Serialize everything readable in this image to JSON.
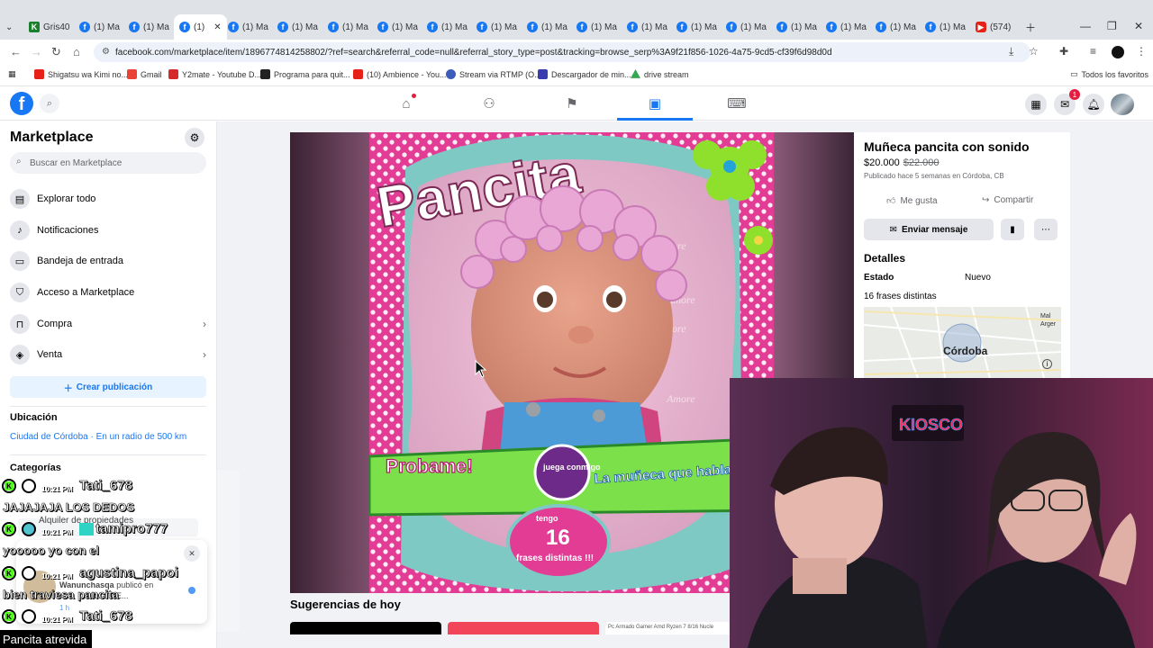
{
  "browser": {
    "tabs": [
      {
        "label": "Gris40"
      },
      {
        "label": "(1) Ma"
      },
      {
        "label": "(1) Ma"
      },
      {
        "label": "(1)"
      },
      {
        "label": "(1) Ma"
      },
      {
        "label": "(1) Ma"
      },
      {
        "label": "(1) Ma"
      },
      {
        "label": "(1) Ma"
      },
      {
        "label": "(1) Ma"
      },
      {
        "label": "(1) Ma"
      },
      {
        "label": "(1) Ma"
      },
      {
        "label": "(1) Ma"
      },
      {
        "label": "(1) Ma"
      },
      {
        "label": "(1) Ma"
      },
      {
        "label": "(1) Ma"
      },
      {
        "label": "(1) Ma"
      },
      {
        "label": "(1) Ma"
      },
      {
        "label": "(1) Ma"
      },
      {
        "label": "(1) Ma"
      },
      {
        "label": "(574)"
      }
    ],
    "url": "facebook.com/marketplace/item/1896774814258802/?ref=search&referral_code=null&referral_story_type=post&tracking=browse_serp%3A9f21f856-1026-4a75-9cd5-cf39f6d98d0d",
    "bookmarks": [
      {
        "label": "Shigatsu wa Kimi no...",
        "color": "#e62117"
      },
      {
        "label": "Gmail",
        "color": "#ea4335"
      },
      {
        "label": "Y2mate - Youtube D...",
        "color": "#d62a2a"
      },
      {
        "label": "Programa para quit...",
        "color": "#222222"
      },
      {
        "label": "(10) Ambience - You...",
        "color": "#e62117"
      },
      {
        "label": "Stream via RTMP (O...",
        "color": "#3b5cb8"
      },
      {
        "label": "Descargador de min...",
        "color": "#3b3bb0"
      },
      {
        "label": "drive stream",
        "color": "#34a853"
      }
    ],
    "all_bookmarks": "Todos los favoritos"
  },
  "sidebar": {
    "title": "Marketplace",
    "search_placeholder": "Buscar en Marketplace",
    "items": [
      {
        "label": "Explorar todo",
        "icon": "store-icon"
      },
      {
        "label": "Notificaciones",
        "icon": "bell-icon"
      },
      {
        "label": "Bandeja de entrada",
        "icon": "inbox-icon"
      },
      {
        "label": "Acceso a Marketplace",
        "icon": "shield-icon"
      },
      {
        "label": "Compra",
        "icon": "bag-icon"
      },
      {
        "label": "Venta",
        "icon": "tag-icon"
      }
    ],
    "create_label": "Crear publicación",
    "location_heading": "Ubicación",
    "location_value": "Ciudad de Córdoba · En un radio de 500 km",
    "categories_heading": "Categorías",
    "category_partial": "Alquiler de propiedades"
  },
  "listing": {
    "title": "Muñeca pancita con sonido",
    "price": "$20.000",
    "old_price": "$22.000",
    "meta": "Publicado hace 5 semanas en Córdoba, CB",
    "like_label": "Me gusta",
    "share_label": "Compartir",
    "message_label": "Enviar mensaje",
    "details_heading": "Detalles",
    "condition_key": "Estado",
    "condition_value": "Nuevo",
    "description": "16 frases distintas",
    "map_city": "Córdoba",
    "map_corner": "Mal Arger"
  },
  "product_box": {
    "brand": "Pancita",
    "badge1": "Probame!",
    "slogan": "La muñeca que habla con vos",
    "bubble": "juega conmigo",
    "count": "16",
    "count_label": "frases distintas !!!",
    "count_prefix": "tengo",
    "watermark": "Amore"
  },
  "suggestions_title": "Sugerencias de hoy",
  "suggestion_card_text": "Pc Armado Gamer Amd Ryzen 7 8/16 Nucle",
  "notification": {
    "author": "Wanunchasqa",
    "text": "publicó en",
    "text2": "VILLA DE...",
    "time": "1 h"
  },
  "chat": [
    {
      "user": "Tati_678",
      "time": "10:21 PM"
    },
    {
      "message": "JAJAJAJA LOS DEDOS"
    },
    {
      "user": "tamipro777",
      "time": "10:21 PM"
    },
    {
      "message": "yooooo yo con el"
    },
    {
      "user": "agustina_papoi",
      "time": "10:21 PM"
    },
    {
      "message": "bien traviesa pancita"
    },
    {
      "user": "Tati_678",
      "time": "10:21 PM"
    }
  ],
  "caption": "Pancita atrevida",
  "webcam": {
    "sign": "KIOSCO"
  },
  "colors": {
    "fb_blue": "#1877f2",
    "kick_green": "#53fc18"
  }
}
